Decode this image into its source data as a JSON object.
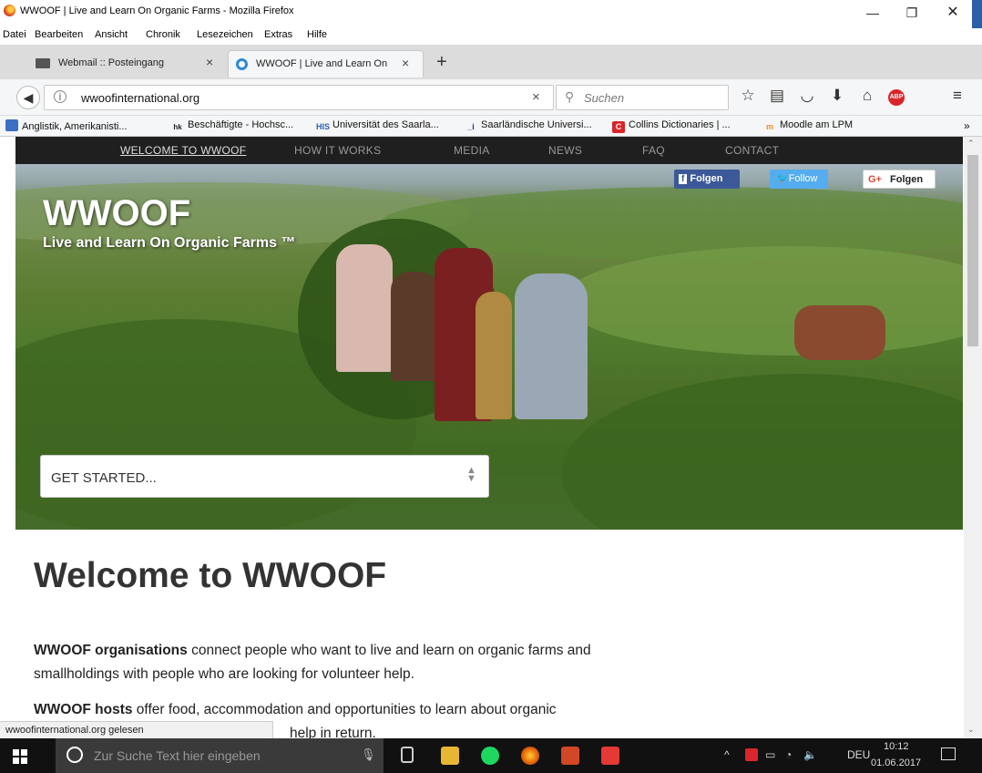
{
  "window": {
    "title": "WWOOF | Live and Learn On Organic Farms - Mozilla Firefox"
  },
  "menu": [
    "Datei",
    "Bearbeiten",
    "Ansicht",
    "Chronik",
    "Lesezeichen",
    "Extras",
    "Hilfe"
  ],
  "tabs": [
    {
      "label": "Webmail :: Posteingang"
    },
    {
      "label": "WWOOF | Live and Learn On"
    }
  ],
  "nav": {
    "url": "wwoofinternational.org",
    "search_placeholder": "Suchen"
  },
  "bookmarks": [
    {
      "label": "Anglistik, Amerikanisti...",
      "color": "#3a6fc4"
    },
    {
      "label": "Beschäftigte - Hochsc...",
      "color": "#4a4a4a"
    },
    {
      "label": "Universität des Saarla...",
      "color": "#2a5fb0"
    },
    {
      "label": "Saarländische Universi...",
      "color": "#1c3c80"
    },
    {
      "label": "Collins Dictionaries | ...",
      "color": "#d8262a"
    },
    {
      "label": "Moodle am LPM",
      "color": "#f28c1c"
    }
  ],
  "site": {
    "nav_items": [
      "WELCOME TO WWOOF",
      "HOW IT WORKS",
      "MEDIA",
      "NEWS",
      "FAQ",
      "CONTACT"
    ],
    "hero_title": "WWOOF",
    "hero_subtitle": "Live and Learn On Organic Farms ™",
    "social": {
      "facebook": "Folgen",
      "twitter": "Follow",
      "gplus": "Folgen"
    },
    "get_started": "GET STARTED...",
    "heading": "Welcome to WWOOF",
    "p1_bold": "WWOOF organisations",
    "p1_rest": " connect people who want to live and learn on organic farms and smallholdings with people who are looking for volunteer help.",
    "p2_bold": "WWOOF hosts",
    "p2_rest": " offer food, accommodation and opportunities to learn about organic",
    "p2_tail": "help in return."
  },
  "status": "wwoofinternational.org gelesen",
  "taskbar": {
    "search": "Zur Suche Text hier eingeben",
    "lang": "DEU",
    "time": "10:12",
    "date": "01.06.2017"
  }
}
